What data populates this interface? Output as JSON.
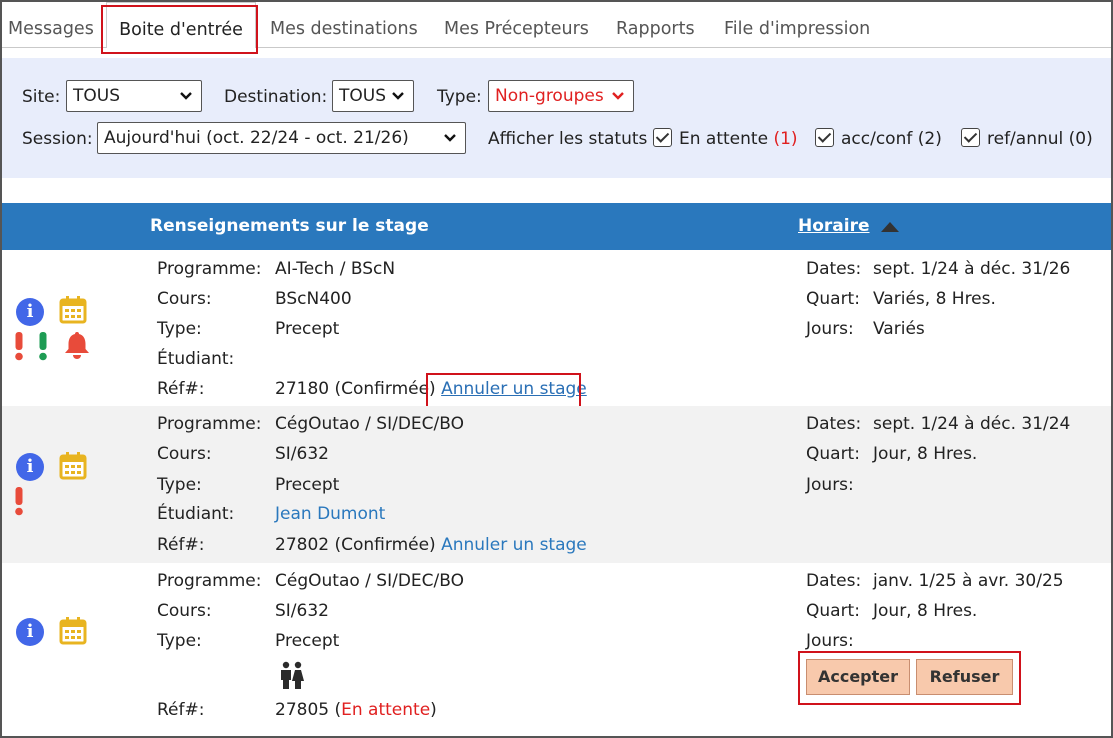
{
  "tabs": [
    {
      "label": "Messages"
    },
    {
      "label": "Boite d'entrée"
    },
    {
      "label": "Mes destinations"
    },
    {
      "label": "Mes Précepteurs"
    },
    {
      "label": "Rapports"
    },
    {
      "label": "File d'impression"
    }
  ],
  "filters": {
    "site_label": "Site:",
    "site_value": "TOUS",
    "destination_label": "Destination:",
    "destination_value": "TOUS",
    "type_label": "Type:",
    "type_value": "Non-groupes",
    "session_label": "Session:",
    "session_value": "Aujourd'hui (oct. 22/24 - oct. 21/26)",
    "statuts_label": "Afficher les statuts",
    "statuses": [
      {
        "label": "En attente",
        "count": "(1)",
        "checked": true
      },
      {
        "label": "acc/conf",
        "count": "(2)",
        "checked": true
      },
      {
        "label": "ref/annul",
        "count": "(0)",
        "checked": true
      }
    ]
  },
  "table": {
    "col_info": "Renseignements sur le stage",
    "col_schedule": "Horaire",
    "field_labels": {
      "programme": "Programme:",
      "cours": "Cours:",
      "type": "Type:",
      "etudiant": "Étudiant:",
      "ref": "Réf#:",
      "dates": "Dates:",
      "quart": "Quart:",
      "jours": "Jours:"
    },
    "rows": [
      {
        "programme": "AI-Tech / BScN",
        "cours": "BScN400",
        "type": "Precept",
        "etudiant": "",
        "ref_num": "27180",
        "ref_status": "(Confirmée)",
        "action_link": "Annuler un stage",
        "dates": "sept. 1/24 à déc. 31/26",
        "quart": "Variés, 8 Hres.",
        "jours": "Variés"
      },
      {
        "programme": "CégOutao / SI/DEC/BO",
        "cours": "SI/632",
        "type": "Precept",
        "etudiant": "Jean Dumont",
        "ref_num": "27802",
        "ref_status": "(Confirmée)",
        "action_link": "Annuler un stage",
        "dates": "sept. 1/24 à déc. 31/24",
        "quart": "Jour, 8 Hres.",
        "jours": ""
      },
      {
        "programme": "CégOutao / SI/DEC/BO",
        "cours": "SI/632",
        "type": "Precept",
        "ref_num": "27805",
        "ref_status_open": "(",
        "ref_status": "En attente",
        "ref_status_close": ")",
        "dates": "janv. 1/25 à avr. 30/25",
        "quart": "Jour, 8 Hres.",
        "jours": "",
        "accept_label": "Accepter",
        "refuse_label": "Refuser"
      }
    ]
  },
  "colors": {
    "header_blue": "#2a78bd",
    "filter_bg": "#e8edfb",
    "highlight_red": "#d0121b",
    "button_peach": "#f8c9ac",
    "info_blue": "#4267e8",
    "calendar_yellow": "#e8b420"
  },
  "icons": [
    "info-icon",
    "calendar-icon",
    "exclamation-icon",
    "bell-icon",
    "people-icon",
    "chevron-down-icon",
    "sort-up-icon",
    "checkbox-icon"
  ]
}
